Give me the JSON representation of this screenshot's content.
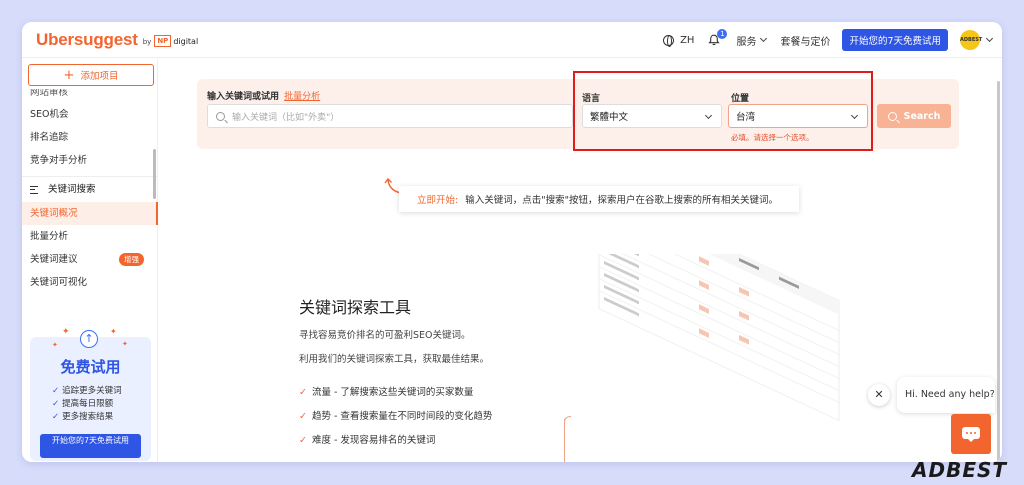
{
  "header": {
    "logo": "Ubersuggest",
    "logo_by": "by",
    "np_badge": "NP",
    "np_digital": "digital",
    "language": "ZH",
    "notif_count": "1",
    "services": "服务",
    "pricing": "套餐与定价",
    "trial_button": "开始您的7天免费试用",
    "avatar_text": "ADBEST"
  },
  "sidebar": {
    "add_project": "添加项目",
    "items_top": [
      {
        "label": "网站审核"
      },
      {
        "label": "SEO机会"
      },
      {
        "label": "排名追踪"
      },
      {
        "label": "竞争对手分析"
      }
    ],
    "section": "关键词搜索",
    "items_kw": [
      {
        "label": "关键词概况",
        "active": true
      },
      {
        "label": "批量分析"
      },
      {
        "label": "关键词建议",
        "badge": "增强"
      },
      {
        "label": "关键词可视化"
      }
    ],
    "promo": {
      "title": "免费试用",
      "bullets": [
        "追踪更多关键词",
        "提高每日限额",
        "更多搜索结果"
      ],
      "button": "开始您的7天免费试用"
    }
  },
  "search": {
    "label": "输入关键词或试用",
    "bulk_link": "批量分析",
    "placeholder": "输入关键词（比如\"外卖\"）",
    "lang_label": "语言",
    "lang_value": "繁體中文",
    "loc_label": "位置",
    "loc_value": "台湾",
    "error": "必填。请选择一个选项。",
    "button": "Search"
  },
  "hint": {
    "highlight": "立即开始:",
    "text": "输入关键词，点击\"搜索\"按钮，探索用户在谷歌上搜索的所有相关关键词。"
  },
  "tool": {
    "title": "关键词探索工具",
    "desc1": "寻找容易竞价排名的可盈利SEO关键词。",
    "desc2": "利用我们的关键词探索工具，获取最佳结果。",
    "features": [
      "流量 - 了解搜索这些关键词的买家数量",
      "趋势 - 查看搜索量在不同时间段的变化趋势",
      "难度 - 发现容易排名的关键词"
    ]
  },
  "chat": {
    "message": "Hi. Need any help?",
    "close": "✕"
  },
  "watermark": "ADBEST",
  "colors": {
    "brand": "#f2652f",
    "primary": "#2f55e4",
    "highlight_frame": "#e11a1a"
  }
}
